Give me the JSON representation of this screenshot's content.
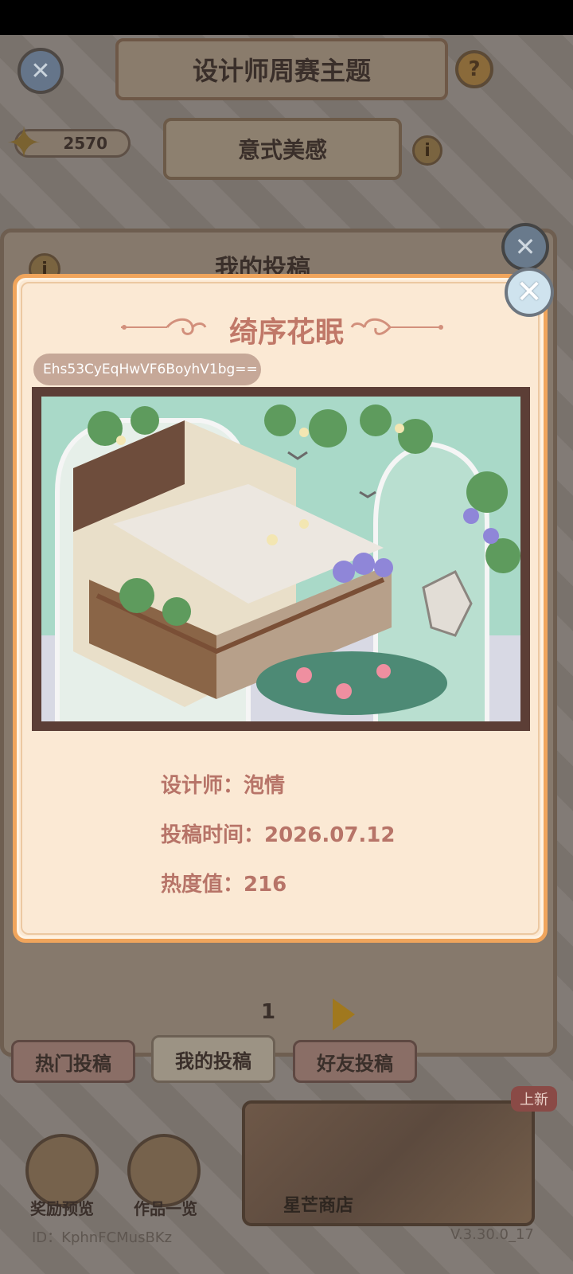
{
  "background": {
    "title": "设计师周赛主题",
    "theme": "意式美感",
    "star_count": "2570",
    "panel_title": "我的投稿",
    "page_number": "1",
    "tabs": [
      "热门投稿",
      "我的投稿",
      "好友投稿"
    ],
    "bottom": {
      "reward_label": "奖励预览",
      "works_label": "作品一览",
      "shop_label": "星芒商店",
      "new_badge": "上新"
    },
    "user_id": "ID：KphnFCMusBKz",
    "version": "V.3.30.0_17"
  },
  "modal": {
    "title": "绮序花眠",
    "code": "Ehs53CyEqHwVF6BoyhV1bg==",
    "designer_line": "设计师：泡情",
    "time_line": "投稿时间：2026.07.12",
    "heat_line": "热度值：216"
  },
  "colors": {
    "modal_bg": "#fbe9d4",
    "modal_border": "#f0a55c",
    "title_text": "#c07868",
    "info_text": "#b77468",
    "art_frame": "#5c3e36",
    "art_sky": "#a9d9c8"
  },
  "icons": {
    "close": "close-icon",
    "help": "question-icon",
    "info": "info-icon",
    "star": "star-icon",
    "next": "next-arrow-icon"
  }
}
